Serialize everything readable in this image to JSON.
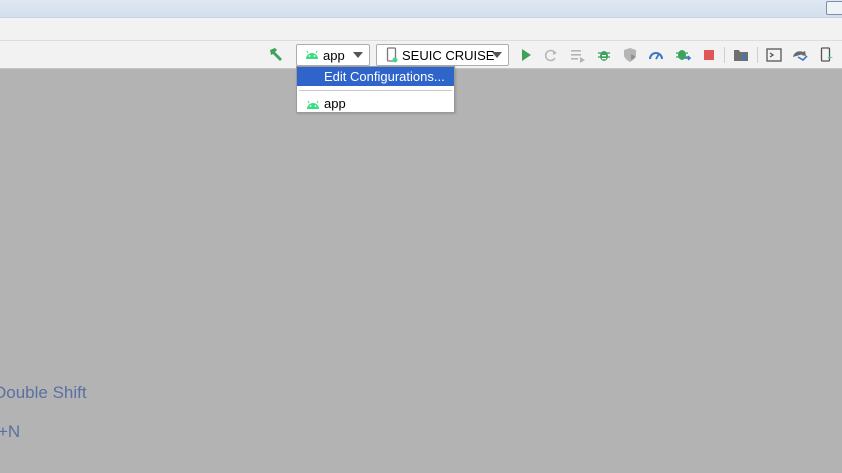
{
  "toolbar": {
    "run_config": {
      "label": "app"
    },
    "device": {
      "label": "SEUIC CRUISE"
    }
  },
  "dropdown": {
    "items": [
      {
        "label": "Edit Configurations..."
      },
      {
        "label": "app"
      }
    ]
  },
  "editor_hints": {
    "line1": "Double Shift",
    "line2": "+N"
  },
  "colors": {
    "android_green": "#3ddc84",
    "run_green": "#3da35a",
    "stop_red": "#e05555",
    "hint_text": "#5a6fa3",
    "menu_highlight": "#2f65ca"
  },
  "icons": [
    "hammer-icon",
    "android-icon",
    "device-icon",
    "run-icon",
    "rerun-icon",
    "apply-changes-icon",
    "debug-icon",
    "coverage-icon",
    "profile-icon",
    "attach-debugger-icon",
    "stop-icon",
    "project-structure-icon",
    "sdk-manager-icon",
    "sync-icon",
    "device-manager-icon"
  ]
}
